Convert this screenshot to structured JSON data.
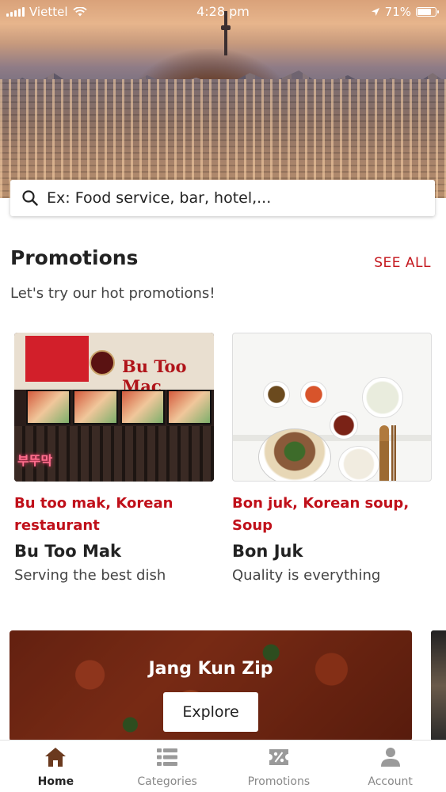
{
  "status_bar": {
    "carrier": "Viettel",
    "time": "4:28 pm",
    "battery": "71%"
  },
  "search": {
    "placeholder": "Ex: Food service, bar, hotel,..."
  },
  "promotions": {
    "title": "Promotions",
    "see_all": "SEE ALL",
    "subtitle": "Let's try our hot promotions!",
    "cards": [
      {
        "image": {
          "sign_text": "Bu Too Mac",
          "neon_text": "부뚜막"
        },
        "category": "Bu too mak, Korean restaurant",
        "name": "Bu Too Mak",
        "description": "Serving the best dish"
      },
      {
        "category": "Bon juk, Korean soup, Soup",
        "name": "Bon Juk",
        "description": "Quality is everything"
      }
    ]
  },
  "banner": {
    "title": "Jang Kun Zip",
    "button": "Explore"
  },
  "tabs": [
    {
      "label": "Home",
      "icon": "home-icon",
      "active": true
    },
    {
      "label": "Categories",
      "icon": "list-icon",
      "active": false
    },
    {
      "label": "Promotions",
      "icon": "ticket-icon",
      "active": false
    },
    {
      "label": "Account",
      "icon": "person-icon",
      "active": false
    }
  ],
  "colors": {
    "accent_red": "#c4161c",
    "active_tab": "#6b3a1f",
    "inactive_tab": "#9a9a9a"
  }
}
